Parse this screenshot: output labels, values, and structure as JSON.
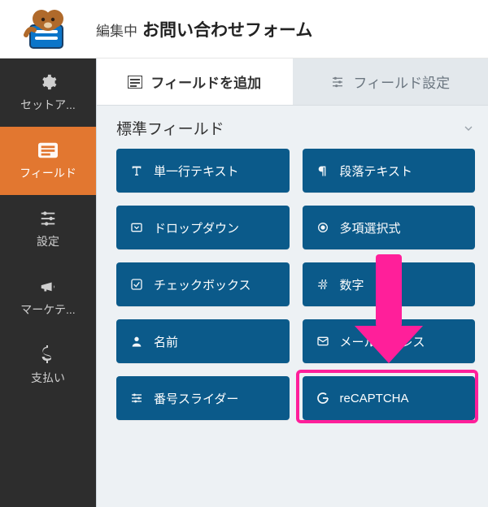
{
  "header": {
    "editing_label": "編集中",
    "form_name": "お問い合わせフォーム"
  },
  "sidebar": {
    "items": [
      {
        "id": "setup",
        "label": "セットア...",
        "icon": "gear"
      },
      {
        "id": "fields",
        "label": "フィールド",
        "icon": "list",
        "active": true
      },
      {
        "id": "settings",
        "label": "設定",
        "icon": "sliders"
      },
      {
        "id": "marketing",
        "label": "マーケテ...",
        "icon": "bullhorn"
      },
      {
        "id": "payments",
        "label": "支払い",
        "icon": "dollar"
      }
    ]
  },
  "tabs": {
    "add_fields": {
      "label": "フィールドを追加",
      "icon": "form"
    },
    "field_options": {
      "label": "フィールド設定",
      "icon": "sliders"
    },
    "active": "add_fields"
  },
  "section": {
    "title": "標準フィールド"
  },
  "fields": [
    {
      "label": "単一行テキスト",
      "icon": "text-t"
    },
    {
      "label": "段落テキスト",
      "icon": "paragraph"
    },
    {
      "label": "ドロップダウン",
      "icon": "dropdown"
    },
    {
      "label": "多項選択式",
      "icon": "radio"
    },
    {
      "label": "チェックボックス",
      "icon": "checkbox"
    },
    {
      "label": "数字",
      "icon": "hash"
    },
    {
      "label": "名前",
      "icon": "user"
    },
    {
      "label": "メールアドレス",
      "icon": "mail"
    },
    {
      "label": "番号スライダー",
      "icon": "sliders"
    },
    {
      "label": "reCAPTCHA",
      "icon": "google-g"
    }
  ],
  "annotation": {
    "highlight_field_index": 9
  }
}
